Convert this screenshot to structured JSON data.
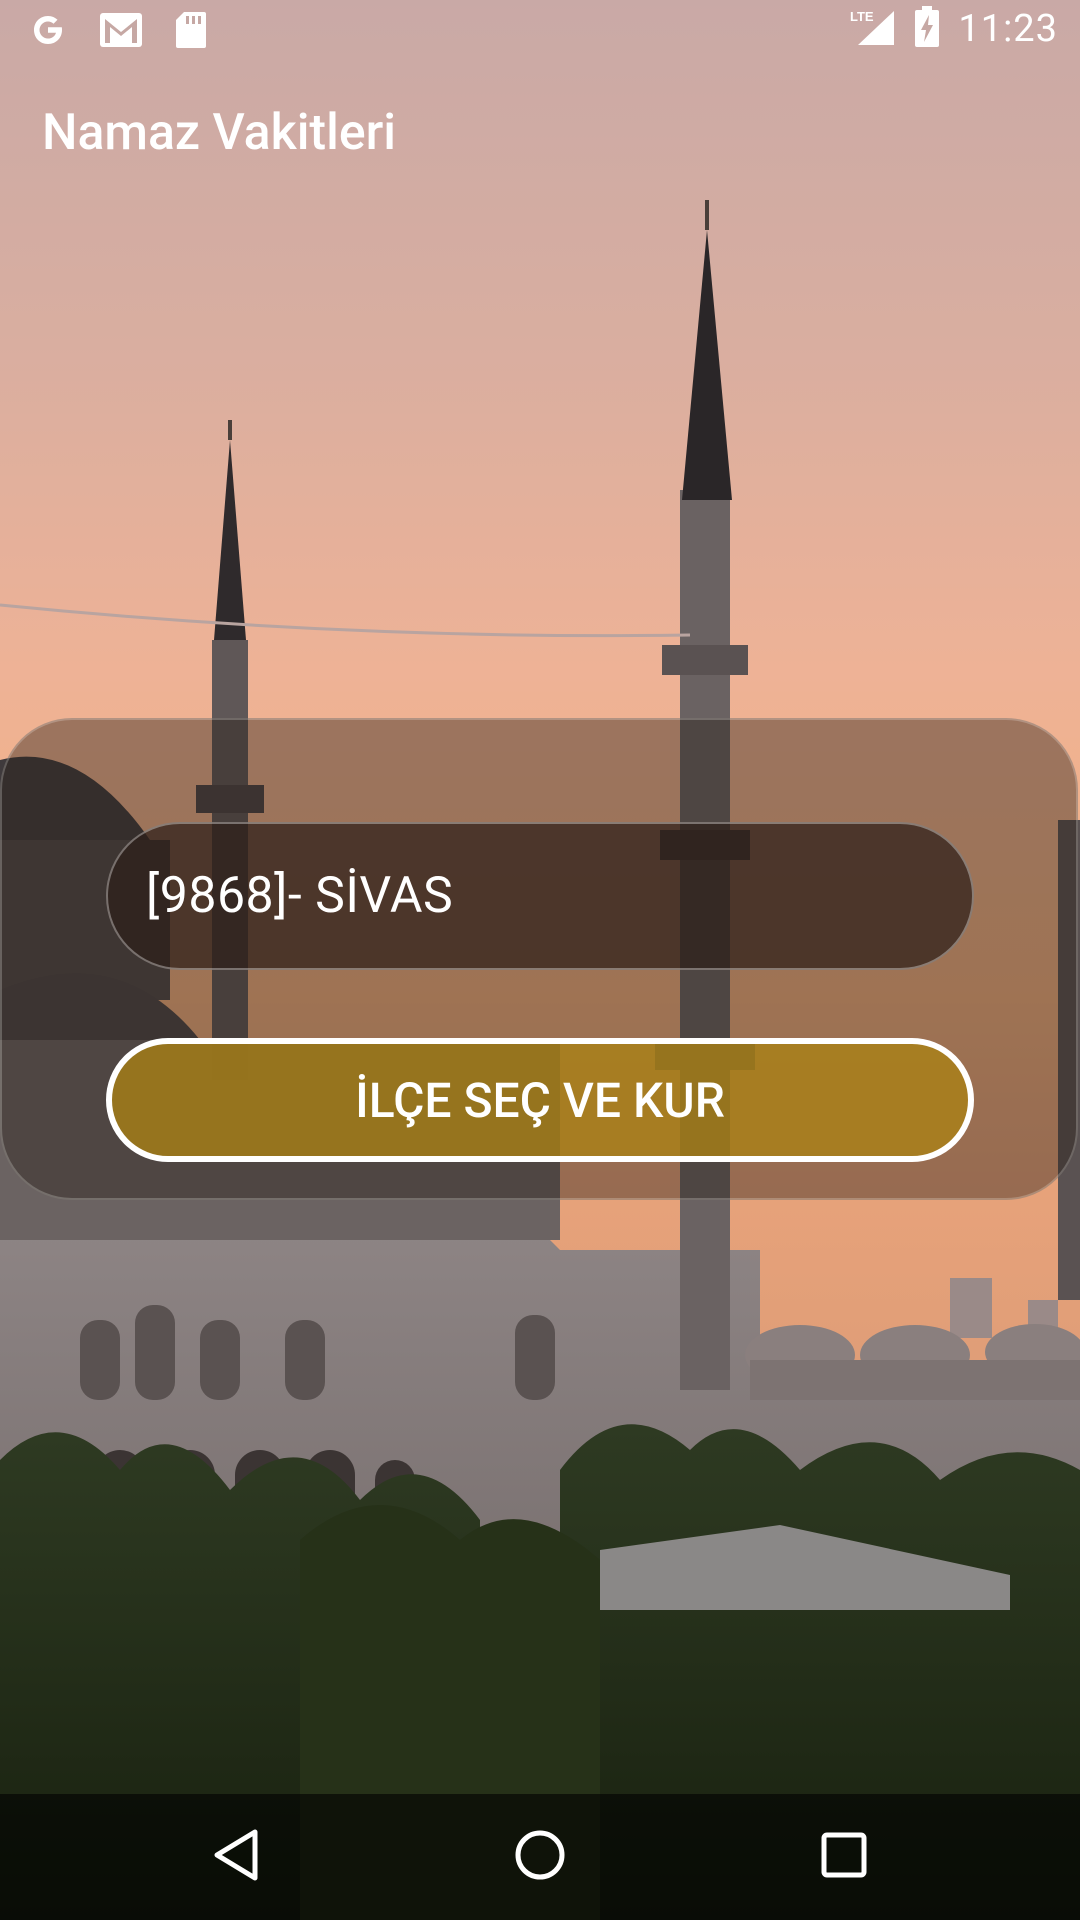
{
  "status_bar": {
    "time": "11:23",
    "network": "LTE",
    "icons": [
      "google-icon",
      "gmail-icon",
      "sd-card-icon",
      "lte-signal-icon",
      "battery-charging-icon"
    ]
  },
  "app": {
    "title": "Namaz Vakitleri"
  },
  "panel": {
    "district_value": "[9868]- SİVAS",
    "button_label": "İLÇE SEÇ VE KUR",
    "button_color": "#AA8214"
  },
  "nav_bar": {
    "icons": [
      "back-icon",
      "home-icon",
      "recents-icon"
    ]
  }
}
